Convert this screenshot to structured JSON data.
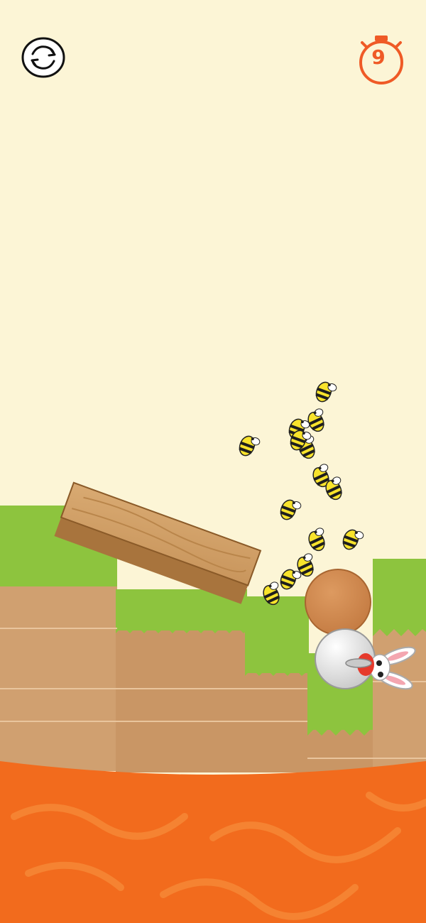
{
  "hud": {
    "restart_icon": "restart-icon",
    "timer_icon": "stopwatch-icon",
    "timer_value": "9"
  },
  "colors": {
    "sky": "#fcf5d6",
    "grass": "#8dc43e",
    "grass_dark": "#76ad2e",
    "dirt": "#d0a070",
    "dirt_line": "#e9c59d",
    "lava": "#f26b1d",
    "lava_light": "#f58332",
    "accent": "#ef5a26",
    "wood": "#d4a46c",
    "bee_yellow": "#f8e32c",
    "bee_black": "#1e1e1e"
  },
  "scene": {
    "bee_count": 14,
    "characters": [
      "bunny",
      "ball",
      "wooden-plank",
      "bee-swarm"
    ]
  }
}
